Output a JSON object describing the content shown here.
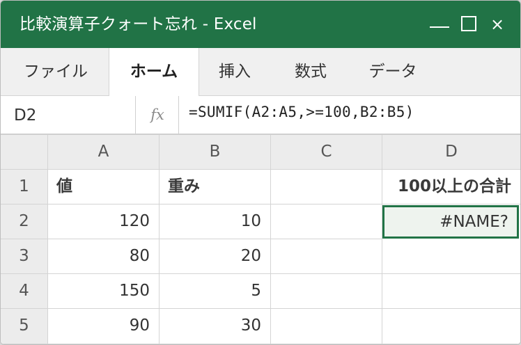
{
  "window": {
    "title": "比較演算子クォート忘れ - Excel",
    "controls": {
      "minimize": "—",
      "maximize": "☐",
      "close": "×"
    }
  },
  "ribbon": {
    "tabs": [
      {
        "label": "ファイル",
        "active": false
      },
      {
        "label": "ホーム",
        "active": true
      },
      {
        "label": "挿入",
        "active": false
      },
      {
        "label": "数式",
        "active": false
      },
      {
        "label": "データ",
        "active": false
      }
    ]
  },
  "formula_bar": {
    "name_box": "D2",
    "fx_label": "fx",
    "formula": "=SUMIF(A2:A5,>=100,B2:B5)"
  },
  "sheet": {
    "columns": [
      "A",
      "B",
      "C",
      "D"
    ],
    "rows": [
      "1",
      "2",
      "3",
      "4",
      "5"
    ],
    "cells": {
      "A1": "値",
      "B1": "重み",
      "C1": "",
      "D1": "100以上の合計",
      "A2": "120",
      "B2": "10",
      "C2": "",
      "D2": "#NAME?",
      "A3": "80",
      "B3": "20",
      "C3": "",
      "D3": "",
      "A4": "150",
      "B4": "5",
      "C4": "",
      "D4": "",
      "A5": "90",
      "B5": "30",
      "C5": "",
      "D5": ""
    },
    "selected_cell": "D2"
  },
  "colors": {
    "accent": "#217346",
    "selection_fill": "#eef3ee",
    "header_bg": "#ececec"
  }
}
